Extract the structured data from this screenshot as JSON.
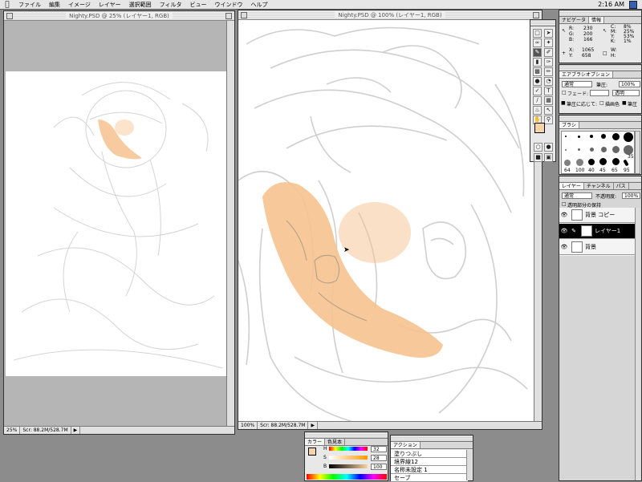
{
  "menubar": {
    "apple": "",
    "items": [
      "ファイル",
      "編集",
      "イメージ",
      "レイヤー",
      "選択範囲",
      "フィルタ",
      "ビュー",
      "ウインドウ",
      "ヘルプ"
    ],
    "clock": "2:16 AM"
  },
  "doc_left": {
    "title": "Nighty.PSD @ 25% (レイヤー1, RGB)",
    "zoom": "25%",
    "size": "Scr: 88.2M/528.7M"
  },
  "doc_main": {
    "title": "Nighty.PSD @ 100% (レイヤー1, RGB)",
    "zoom": "100%",
    "size": "Scr: 88.2M/528.7M"
  },
  "info_panel": {
    "tabs": [
      "ナビゲータ",
      "情報"
    ],
    "rgb": {
      "r_label": "R:",
      "r": "230",
      "g_label": "G:",
      "g": "200",
      "b_label": "B:",
      "b": "166"
    },
    "cmyk": {
      "c_label": "C:",
      "c": "8%",
      "m_label": "M:",
      "m": "25%",
      "y_label": "Y:",
      "y": "53%",
      "k_label": "K:",
      "k": "1%"
    },
    "xy": {
      "x_label": "X:",
      "x": "1065",
      "y_label": "Y:",
      "y": "658"
    },
    "wh": {
      "w_label": "W:",
      "h_label": "H:"
    }
  },
  "options_panel": {
    "title": "エアブラシオプション",
    "mode": "通常",
    "pressure_label": "筆圧:",
    "pressure": "100%",
    "fade_label": "フェード:",
    "fade_to": "透明",
    "stylus_label": "筆圧に応じて:",
    "stylus_opt1": "描画色",
    "stylus_opt2": "筆圧"
  },
  "brushes_panel": {
    "title": "ブラシ",
    "labels": [
      "64",
      "100",
      "40",
      "45",
      "65",
      "35",
      "95"
    ]
  },
  "layers_panel": {
    "tabs": [
      "レイヤー",
      "チャンネル",
      "パス"
    ],
    "mode": "通常",
    "opacity_label": "不透明度:",
    "opacity": "100%",
    "preserve_label": "透明部分の保持",
    "layers": [
      {
        "name": "背景 コピー",
        "selected": false
      },
      {
        "name": "レイヤー1",
        "selected": true
      },
      {
        "name": "背景",
        "selected": false
      }
    ]
  },
  "color_panel": {
    "tabs": [
      "カラー",
      "色見本"
    ],
    "h_label": "H",
    "h": "32",
    "s_label": "S",
    "s": "28",
    "b_label": "B",
    "b": "100"
  },
  "actions_panel": {
    "tab": "アクション",
    "items": [
      "塗りつぶし",
      "境界線12",
      "名称未設定 1",
      "セーブ"
    ]
  },
  "colors": {
    "foreground": "#f8d3a6",
    "background": "#ffffff",
    "skin": "#f6c28e"
  }
}
